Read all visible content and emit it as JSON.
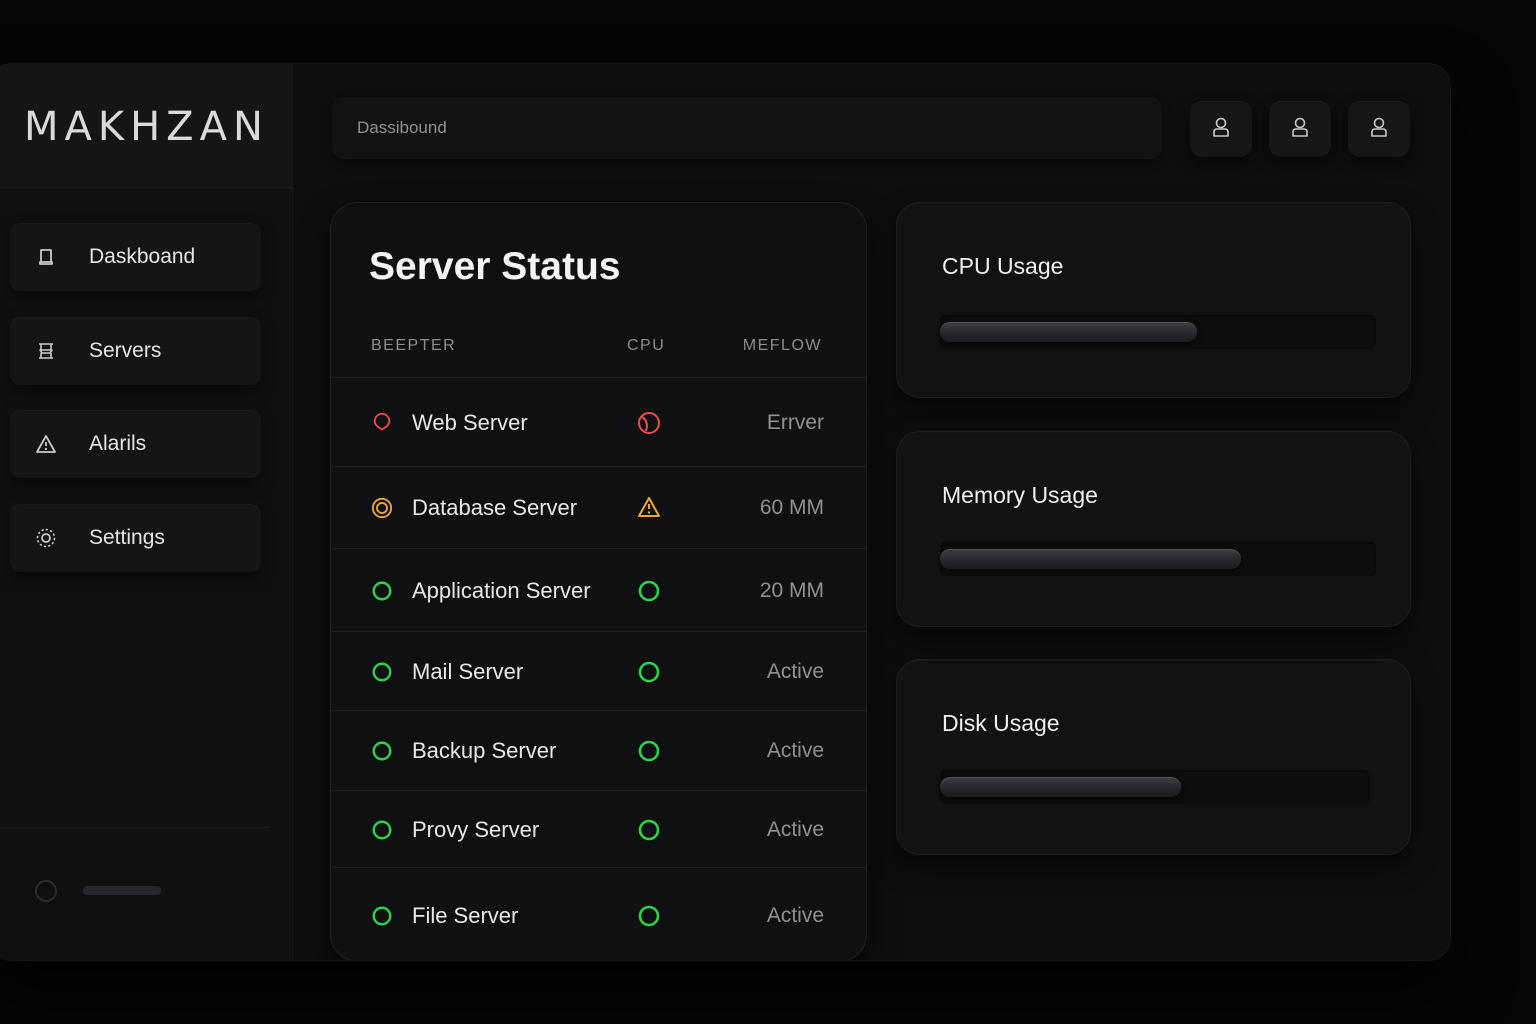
{
  "brand": "MAKHZAN",
  "search": {
    "placeholder": "Dassibound"
  },
  "topbar": {
    "buttons": [
      {
        "icon": "user-icon"
      },
      {
        "icon": "user-icon"
      },
      {
        "icon": "user-icon"
      }
    ]
  },
  "sidebar": {
    "items": [
      {
        "label": "Daskboand",
        "icon": "dashboard-icon"
      },
      {
        "label": "Servers",
        "icon": "server-icon"
      },
      {
        "label": "Alarils",
        "icon": "warning-icon"
      },
      {
        "label": "Settings",
        "icon": "gear-icon"
      }
    ]
  },
  "status": {
    "title": "Server Status",
    "columns": [
      "BEEPTER",
      "CPU",
      "MEFLOW"
    ],
    "rows": [
      {
        "name": "Web Server",
        "value": "Errver",
        "status": "error",
        "cpu": "error"
      },
      {
        "name": "Database Server",
        "value": "60 MM",
        "status": "warning",
        "cpu": "warning"
      },
      {
        "name": "Application Server",
        "value": "20 MM",
        "status": "ok",
        "cpu": "ok"
      },
      {
        "name": "Mail Server",
        "value": "Active",
        "status": "ok",
        "cpu": "ok"
      },
      {
        "name": "Backup Server",
        "value": "Active",
        "status": "ok",
        "cpu": "ok"
      },
      {
        "name": "Provy Server",
        "value": "Active",
        "status": "ok",
        "cpu": "ok"
      },
      {
        "name": "File Server",
        "value": "Active",
        "status": "ok",
        "cpu": "ok"
      }
    ]
  },
  "usage": [
    {
      "title": "CPU Usage",
      "fraction": 0.59
    },
    {
      "title": "Memory Usage",
      "fraction": 0.69
    },
    {
      "title": "Disk Usage",
      "fraction": 0.56
    }
  ],
  "colors": {
    "error": "#ef4b4b",
    "warning": "#f0a63a",
    "ok": "#2fd34a"
  }
}
